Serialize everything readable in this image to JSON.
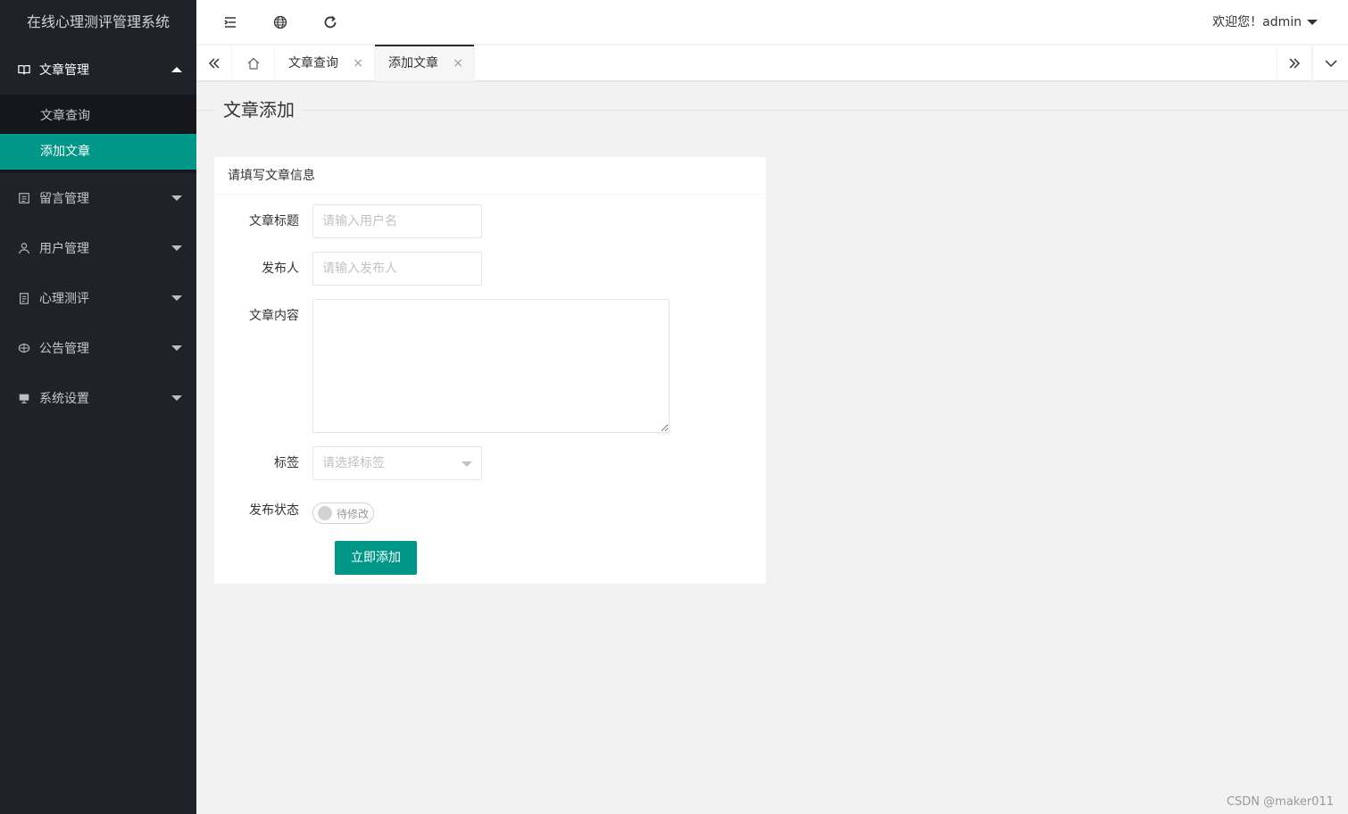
{
  "app": {
    "title": "在线心理测评管理系统"
  },
  "sidebar": {
    "groups": [
      {
        "label": "文章管理",
        "icon": "book-icon",
        "expanded": true,
        "children": [
          {
            "label": "文章查询",
            "active": false
          },
          {
            "label": "添加文章",
            "active": true
          }
        ]
      },
      {
        "label": "留言管理",
        "icon": "message-icon",
        "expanded": false
      },
      {
        "label": "用户管理",
        "icon": "user-icon",
        "expanded": false
      },
      {
        "label": "心理测评",
        "icon": "clipboard-icon",
        "expanded": false
      },
      {
        "label": "公告管理",
        "icon": "announcement-icon",
        "expanded": false
      },
      {
        "label": "系统设置",
        "icon": "settings-icon",
        "expanded": false
      }
    ]
  },
  "header": {
    "tools": [
      "menu-fold-icon",
      "globe-icon",
      "refresh-icon"
    ],
    "user_greeting": "欢迎您！admin"
  },
  "tabs": {
    "items": [
      {
        "label": "文章查询",
        "active": false
      },
      {
        "label": "添加文章",
        "active": true
      }
    ],
    "close_glyph": "×"
  },
  "page": {
    "title": "文章添加",
    "card_title": "请填写文章信息",
    "form": {
      "title_label": "文章标题",
      "title_placeholder": "请输入用户名",
      "author_label": "发布人",
      "author_placeholder": "请输入发布人",
      "content_label": "文章内容",
      "tag_label": "标签",
      "tag_placeholder": "请选择标签",
      "status_label": "发布状态",
      "status_switch_text": "待修改",
      "submit_label": "立即添加"
    }
  },
  "watermark": "CSDN @maker011",
  "colors": {
    "accent": "#009688",
    "sidebar_bg": "#20222a"
  }
}
